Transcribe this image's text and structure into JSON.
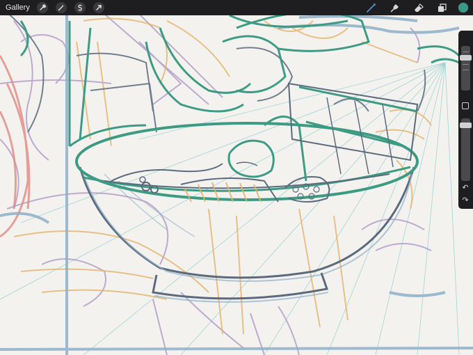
{
  "app": {
    "gallery_label": "Gallery",
    "accent_color": "#3a9a86"
  },
  "toolbar": {
    "left_tools": [
      "wrench-icon",
      "magic-wand-icon",
      "selection-icon",
      "transform-arrow-icon"
    ],
    "right_tools": [
      "brush-icon",
      "smudge-icon",
      "eraser-icon",
      "layers-icon",
      "color-swatch"
    ]
  },
  "sidebar": {
    "brush_size_level": 0.08,
    "opacity_level": 0.15,
    "undo_icon": "undo-icon",
    "redo_icon": "redo-icon"
  },
  "canvas": {
    "subject": "sketch",
    "stroke_colors": {
      "green": "#3d9b84",
      "slate": "#5b6a7c",
      "blue": "#8fb0c8",
      "orange": "#e3b36a",
      "purple": "#ab92c5",
      "red": "#e08a86",
      "cyan": "#9fd3d3"
    }
  }
}
